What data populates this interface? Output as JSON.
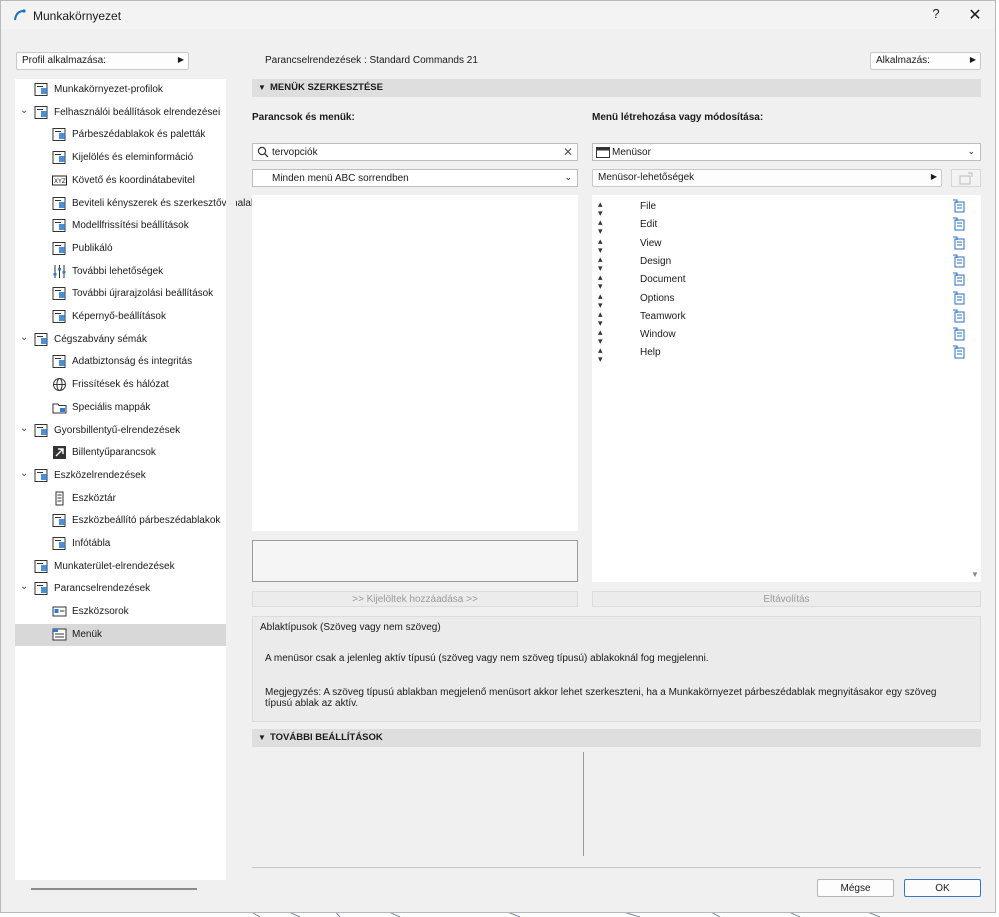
{
  "window": {
    "title": "Munkakörnyezet",
    "help_label": "?",
    "close_label": "✕"
  },
  "profile_button": {
    "label": "Profil alkalmazása:"
  },
  "command_layout": {
    "label": "Parancselrendezések : Standard Commands 21"
  },
  "apply_button": {
    "label": "Alkalmazás:"
  },
  "tree": [
    {
      "label": "Munkakörnyezet-profilok",
      "icon": "profiles-icon",
      "level": 0,
      "expandable": false
    },
    {
      "label": "Felhasználói beállítások elrendezései",
      "icon": "user-settings-icon",
      "level": 0,
      "expandable": true
    },
    {
      "label": "Párbeszédablakok és paletták",
      "icon": "dialogs-icon",
      "level": 1
    },
    {
      "label": "Kijelölés és eleminformáció",
      "icon": "selection-icon",
      "level": 1
    },
    {
      "label": "Követő és koordinátabevitel",
      "icon": "xyz-icon",
      "level": 1
    },
    {
      "label": "Beviteli kényszerek és szerkesztővonalak",
      "icon": "input-constraints-icon",
      "level": 1
    },
    {
      "label": "Modellfrissítési beállítások",
      "icon": "model-update-icon",
      "level": 1
    },
    {
      "label": "Publikáló",
      "icon": "publisher-icon",
      "level": 1
    },
    {
      "label": "További lehetőségek",
      "icon": "more-options-icon",
      "level": 1
    },
    {
      "label": "További újrarajzolási beállítások",
      "icon": "redraw-icon",
      "level": 1
    },
    {
      "label": "Képernyő-beállítások",
      "icon": "screen-icon",
      "level": 1
    },
    {
      "label": "Cégszabvány sémák",
      "icon": "company-standards-icon",
      "level": 0,
      "expandable": true
    },
    {
      "label": "Adatbiztonság és integritás",
      "icon": "data-safety-icon",
      "level": 1
    },
    {
      "label": "Frissítések és hálózat",
      "icon": "globe-icon",
      "level": 1
    },
    {
      "label": "Speciális mappák",
      "icon": "folder-icon",
      "level": 1
    },
    {
      "label": "Gyorsbillentyű-elrendezések",
      "icon": "shortcut-schemes-icon",
      "level": 0,
      "expandable": true
    },
    {
      "label": "Billentyűparancsok",
      "icon": "keyboard-shortcut-icon",
      "level": 1
    },
    {
      "label": "Eszközelrendezések",
      "icon": "tool-schemes-icon",
      "level": 0,
      "expandable": true
    },
    {
      "label": "Eszköztár",
      "icon": "toolbox-icon",
      "level": 1
    },
    {
      "label": "Eszközbeállító párbeszédablakok",
      "icon": "tool-settings-icon",
      "level": 1
    },
    {
      "label": "Infótábla",
      "icon": "info-box-icon",
      "level": 1
    },
    {
      "label": "Munkaterület-elrendezések",
      "icon": "workspace-icon",
      "level": 0,
      "expandable": false
    },
    {
      "label": "Parancselrendezések",
      "icon": "command-schemes-icon",
      "level": 0,
      "expandable": true
    },
    {
      "label": "Eszközsorok",
      "icon": "toolbars-icon",
      "level": 1
    },
    {
      "label": "Menük",
      "icon": "menus-icon",
      "level": 1,
      "selected": true
    }
  ],
  "menus_section": {
    "title": "MENÜK SZERKESZTÉSE"
  },
  "commands": {
    "heading": "Parancsok és menük:",
    "search_value": "tervopciók",
    "filter_value": "Minden menü ABC sorrendben",
    "add_button": ">> Kijelöltek hozzáadása >>"
  },
  "menu_edit": {
    "heading": "Menü létrehozása vagy módosítása:",
    "menubar_value": "Menüsor",
    "options_label": "Menüsor-lehetőségek",
    "items": [
      "File",
      "Edit",
      "View",
      "Design",
      "Document",
      "Options",
      "Teamwork",
      "Window",
      "Help"
    ],
    "remove_button": "Eltávolítás"
  },
  "info": {
    "title": "Ablaktípusok (Szöveg vagy nem szöveg)",
    "line1": "A menüsor csak a jelenleg aktív típusú (szöveg vagy nem szöveg típusú) ablakoknál fog megjelenni.",
    "line2a": "Megjegyzés: A szöveg típusú ablakban megjelenő menüsort akkor lehet szerkeszteni, ha a Munkakörnyezet párbeszédablak megnyitásakor egy szöveg",
    "line2b": "típusú ablak az aktív."
  },
  "more_section": {
    "title": "TOVÁBBI BEÁLLÍTÁSOK"
  },
  "footer": {
    "cancel": "Mégse",
    "ok": "OK"
  },
  "colors": {
    "accent": "#1a6fc9",
    "selection": "#d8d8d8",
    "window_bg": "#f0f0f0"
  }
}
